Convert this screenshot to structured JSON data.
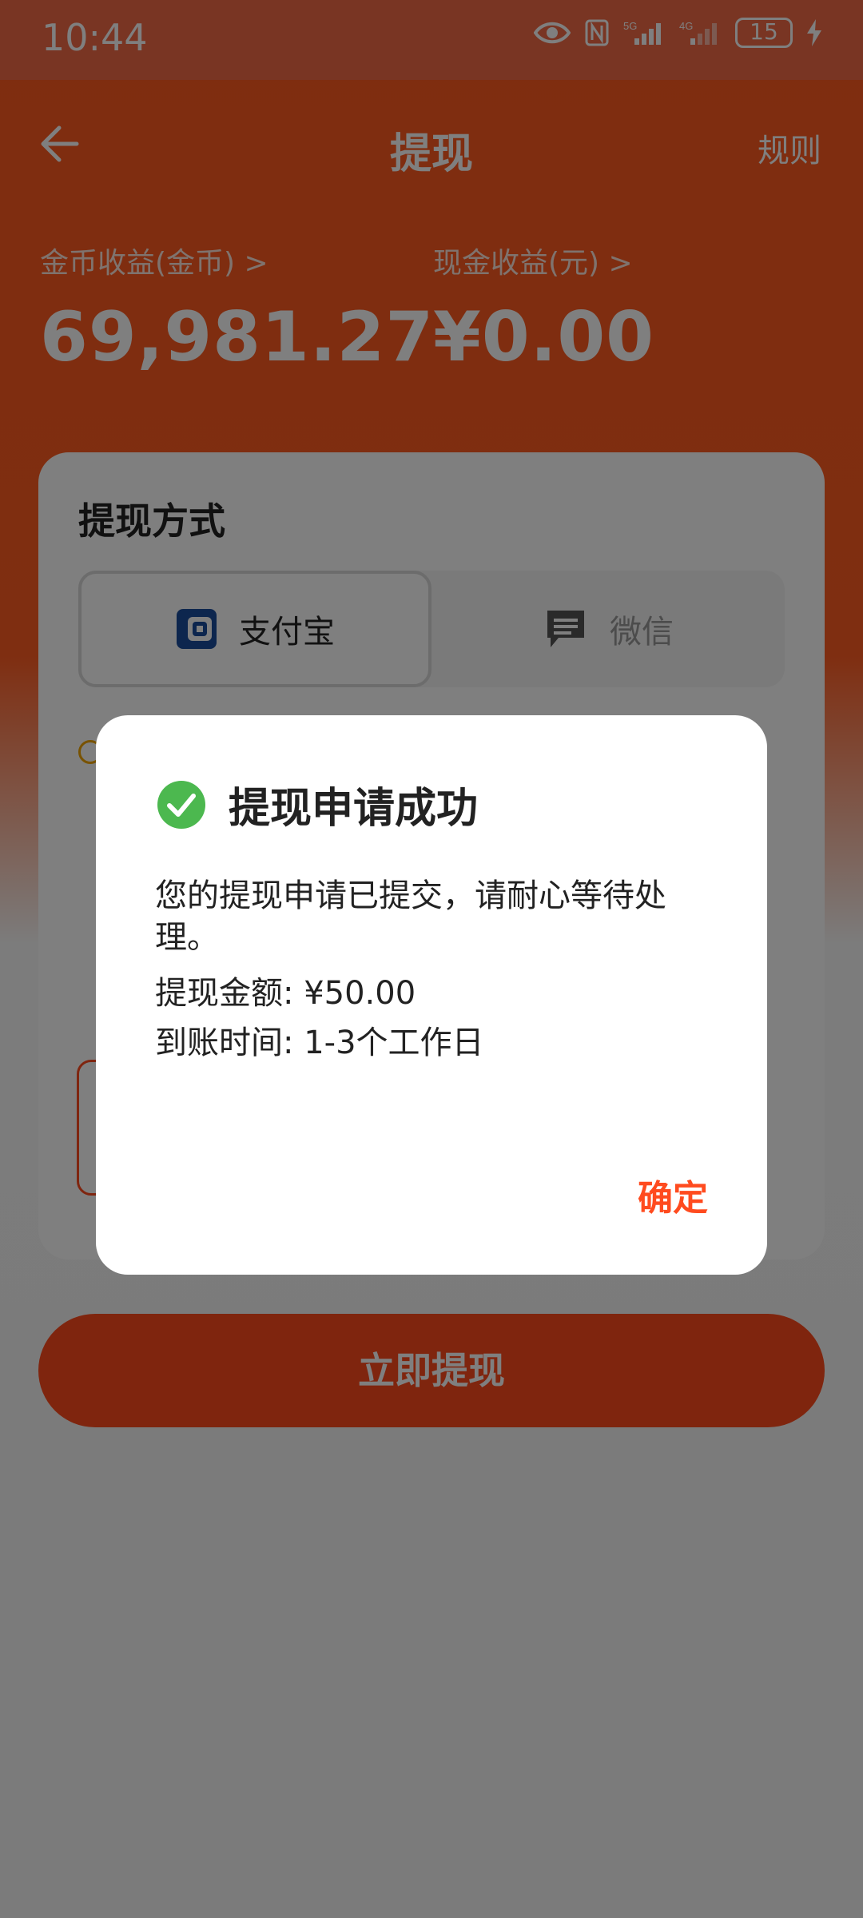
{
  "status_bar": {
    "time": "10:44",
    "network_1": "5G",
    "network_2": "4G",
    "battery": "15",
    "icons": [
      "eye-icon",
      "nfc-icon",
      "signal-5g-icon",
      "signal-4g-icon",
      "battery-icon",
      "charging-icon"
    ]
  },
  "header": {
    "title": "提现",
    "rules_label": "规则"
  },
  "stats": {
    "coin_label": "金币收益(金币) >",
    "coin_value": "69,981.27",
    "cash_label": "现金收益(元) >",
    "cash_value": "¥0.00"
  },
  "card": {
    "title": "提现方式",
    "methods": [
      {
        "label": "支付宝",
        "icon": "alipay-icon",
        "selected": true
      },
      {
        "label": "微信",
        "icon": "wechat-icon",
        "selected": false
      }
    ]
  },
  "withdraw_button": {
    "label": "立即提现"
  },
  "dialog": {
    "title": "提现申请成功",
    "message": "您的提现申请已提交，请耐心等待处理。",
    "amount_line": "提现金额: ¥50.00",
    "time_line": "到账时间: 1-3个工作日",
    "confirm_label": "确定"
  },
  "colors": {
    "brand_orange": "#ff4b1c",
    "success_green": "#4cb84f",
    "alipay_blue": "#1a4c9c"
  }
}
